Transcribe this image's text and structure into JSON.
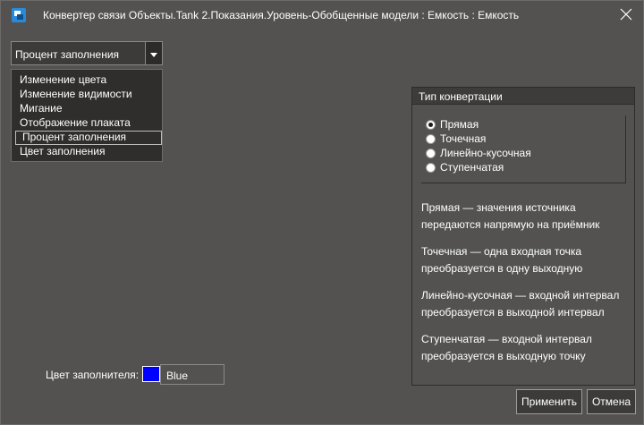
{
  "window": {
    "title": "Конвертер связи Объекты.Tank 2.Показания.Уровень-Обобщенные модели : Емкость : Емкость",
    "app_icon": "app-logo-icon",
    "close_icon": "close-icon"
  },
  "property_combo": {
    "value": "Процент заполнения",
    "arrow_icon": "caret-down-icon",
    "options": [
      "Изменение цвета",
      "Изменение видимости",
      "Мигание",
      "Отображение плаката",
      "Процент заполнения",
      "Цвет заполнения"
    ],
    "selected_index": 4
  },
  "conversion_type": {
    "title": "Тип конвертации",
    "options": [
      "Прямая",
      "Точечная",
      "Линейно-кусочная",
      "Ступенчатая"
    ],
    "selected_index": 0,
    "descriptions": [
      "Прямая — значения источника передаются напрямую на приёмник",
      "Точечная — одна входная точка преобразуется в одну выходную",
      "Линейно-кусочная — входной интервал преобразуется в выходной интервал",
      "Ступенчатая — входной интервал преобразуется в выходную точку"
    ]
  },
  "fill_color": {
    "label": "Цвет заполнителя:",
    "swatch_color": "#0000ff",
    "value": "Blue"
  },
  "buttons": {
    "apply": "Применить",
    "cancel": "Отмена"
  },
  "colors": {
    "window_bg": "#535250",
    "header_bg": "#3d3c3b",
    "dropdown_bg": "#2f2e2d"
  }
}
